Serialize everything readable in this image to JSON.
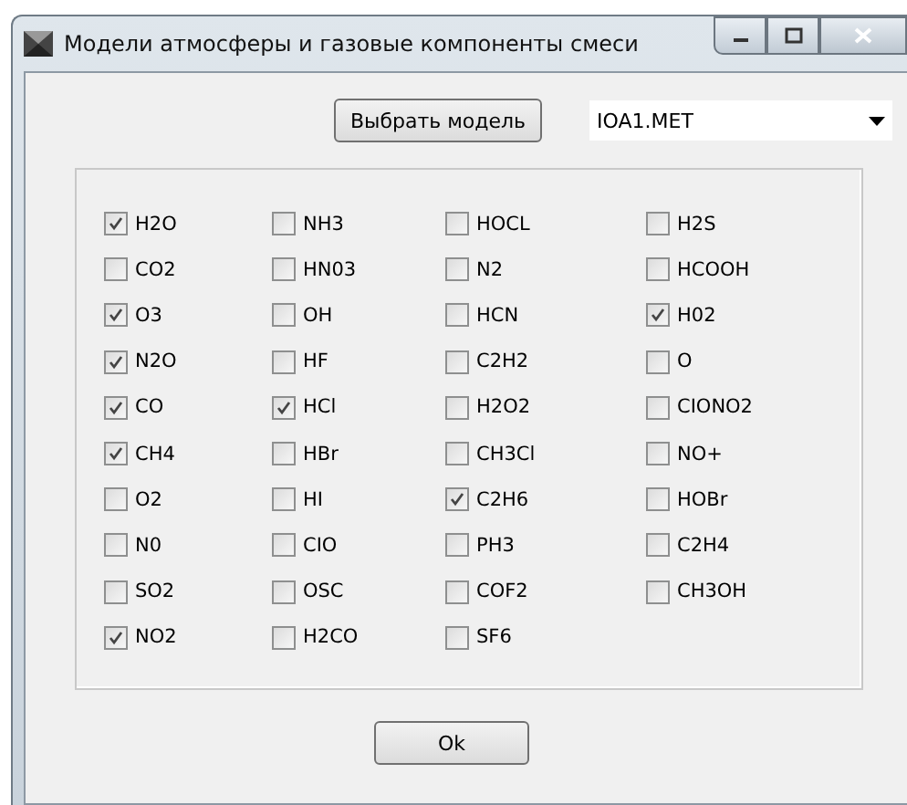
{
  "window": {
    "title": "Модели атмосферы и газовые компоненты смеси"
  },
  "choose_button": "Выбрать модель",
  "model_combo": {
    "value": "IOA1.MET"
  },
  "gases": [
    {
      "label": "H2O",
      "checked": true
    },
    {
      "label": "NH3",
      "checked": false
    },
    {
      "label": "HOCL",
      "checked": false
    },
    {
      "label": "H2S",
      "checked": false
    },
    {
      "label": "CO2",
      "checked": false
    },
    {
      "label": "HN03",
      "checked": false
    },
    {
      "label": "N2",
      "checked": false
    },
    {
      "label": "HCOOH",
      "checked": false
    },
    {
      "label": "O3",
      "checked": true
    },
    {
      "label": "OH",
      "checked": false
    },
    {
      "label": "HCN",
      "checked": false
    },
    {
      "label": "H02",
      "checked": true
    },
    {
      "label": "N2O",
      "checked": true
    },
    {
      "label": "HF",
      "checked": false
    },
    {
      "label": "C2H2",
      "checked": false
    },
    {
      "label": "O",
      "checked": false
    },
    {
      "label": "CO",
      "checked": true
    },
    {
      "label": "HCl",
      "checked": true
    },
    {
      "label": "H2O2",
      "checked": false
    },
    {
      "label": "CIONO2",
      "checked": false
    },
    {
      "label": "CH4",
      "checked": true
    },
    {
      "label": "HBr",
      "checked": false
    },
    {
      "label": "CH3Cl",
      "checked": false
    },
    {
      "label": "NO+",
      "checked": false
    },
    {
      "label": "O2",
      "checked": false
    },
    {
      "label": "HI",
      "checked": false
    },
    {
      "label": "C2H6",
      "checked": true
    },
    {
      "label": "HOBr",
      "checked": false
    },
    {
      "label": "N0",
      "checked": false
    },
    {
      "label": "CIO",
      "checked": false
    },
    {
      "label": "PH3",
      "checked": false
    },
    {
      "label": "C2H4",
      "checked": false
    },
    {
      "label": "SO2",
      "checked": false
    },
    {
      "label": "OSC",
      "checked": false
    },
    {
      "label": "COF2",
      "checked": false
    },
    {
      "label": "CH3OH",
      "checked": false
    },
    {
      "label": "NO2",
      "checked": true
    },
    {
      "label": "H2CO",
      "checked": false
    },
    {
      "label": "SF6",
      "checked": false
    }
  ],
  "ok_button": "Ok"
}
